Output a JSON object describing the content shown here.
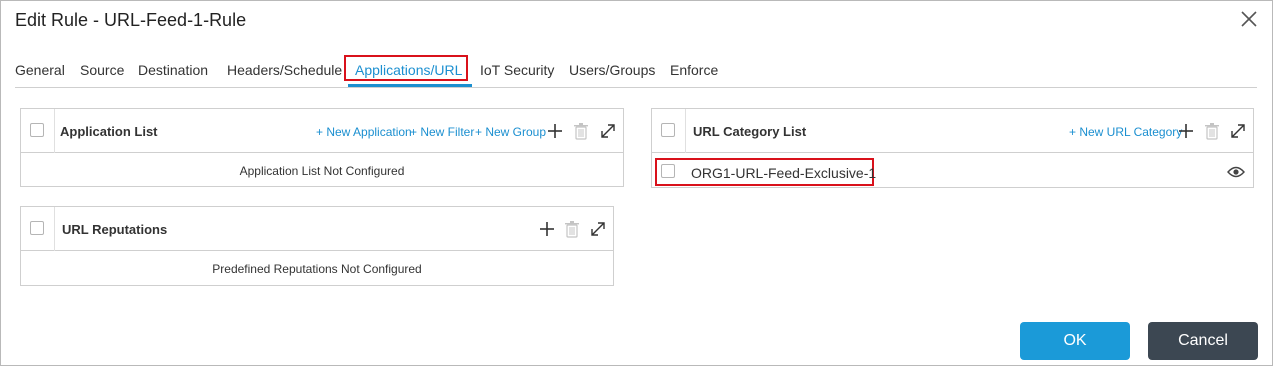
{
  "dialog": {
    "title": "Edit Rule - URL-Feed-1-Rule",
    "close_icon": "close-icon"
  },
  "tabs": [
    {
      "label": "General"
    },
    {
      "label": "Source"
    },
    {
      "label": "Destination"
    },
    {
      "label": "Headers/Schedule"
    },
    {
      "label": "Applications/URL",
      "active": true
    },
    {
      "label": "IoT Security"
    },
    {
      "label": "Users/Groups"
    },
    {
      "label": "Enforce"
    }
  ],
  "application_list": {
    "title": "Application List",
    "new_application": "+ New Application",
    "new_filter": "+ New Filter",
    "new_group": "+ New Group",
    "empty_text": "Application List Not Configured"
  },
  "url_reputations": {
    "title": "URL Reputations",
    "empty_text": "Predefined Reputations Not Configured"
  },
  "url_category_list": {
    "title": "URL Category List",
    "new_url_category": "+ New URL Category",
    "rows": [
      {
        "name": "ORG1-URL-Feed-Exclusive-1"
      }
    ]
  },
  "buttons": {
    "ok": "OK",
    "cancel": "Cancel"
  },
  "colors": {
    "accent": "#1b8fd0",
    "highlight": "#d9111b",
    "ok_button": "#1b9ad8",
    "cancel_button": "#3c4752"
  }
}
